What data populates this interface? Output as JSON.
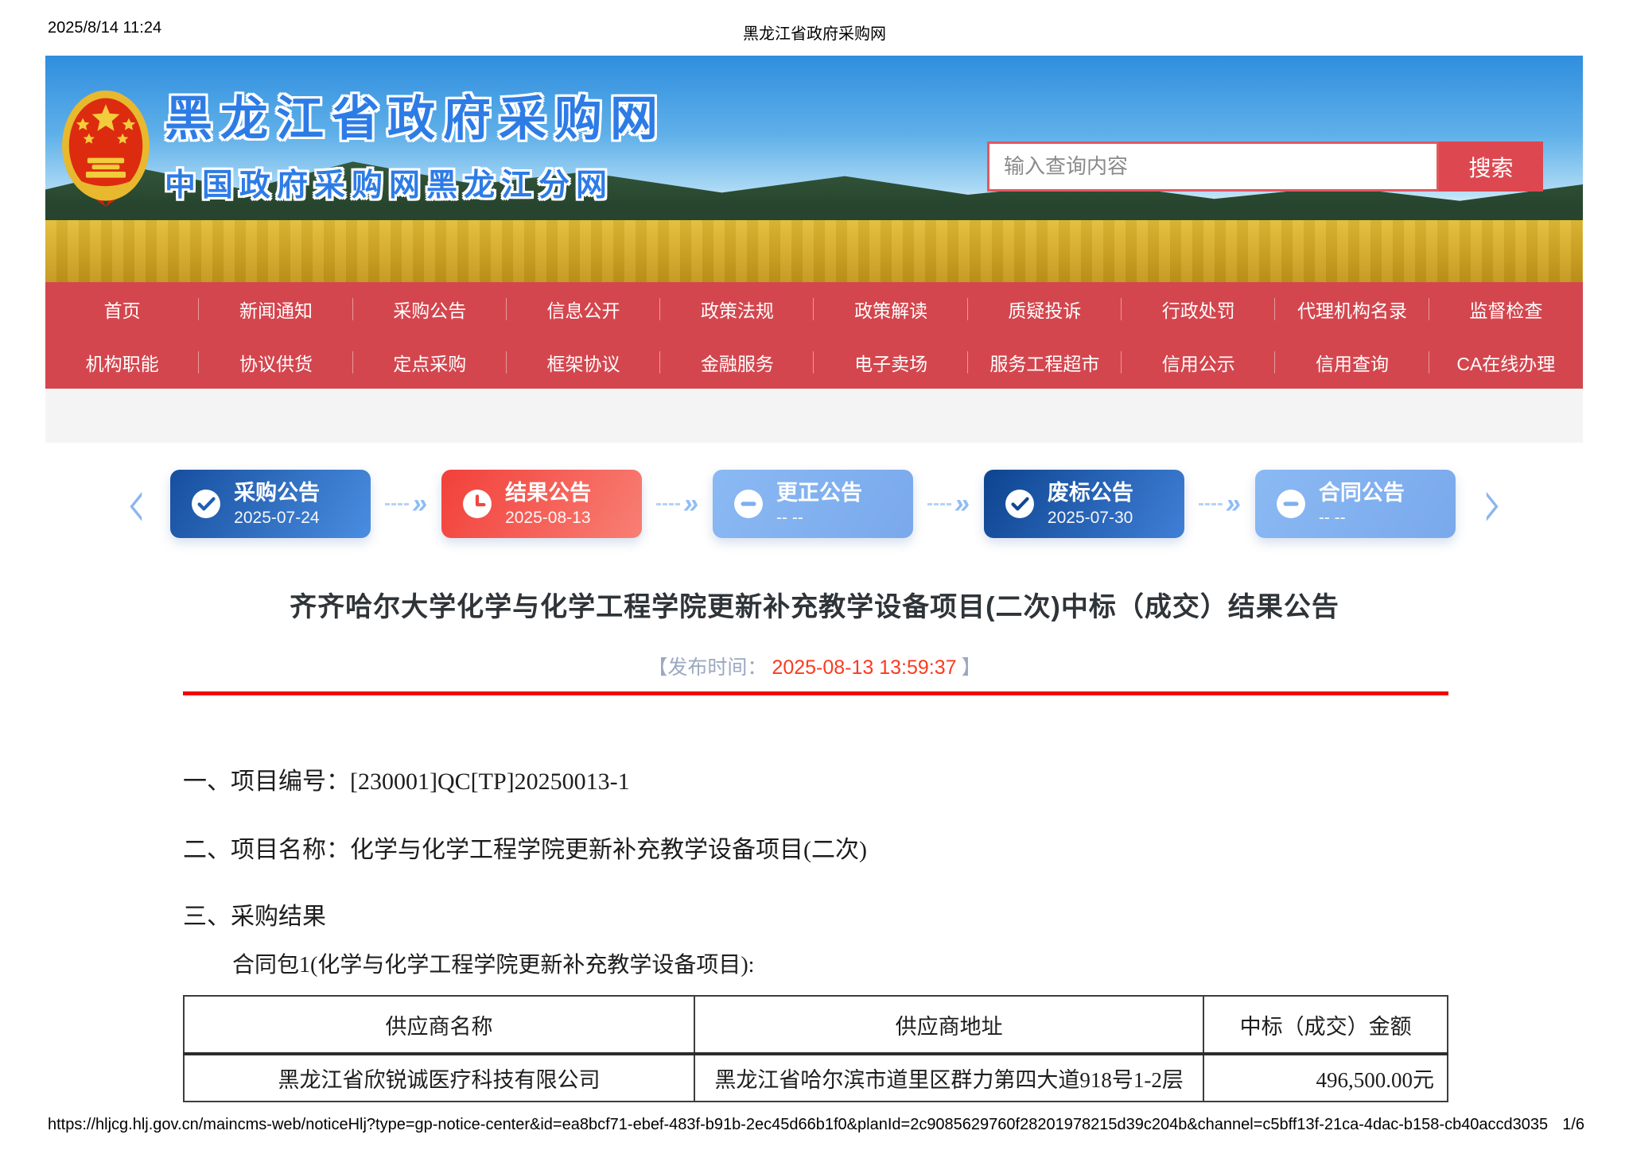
{
  "print_header": {
    "timestamp": "2025/8/14 11:24",
    "doc_title": "黑龙江省政府采购网"
  },
  "banner": {
    "site_title": "黑龙江省政府采购网",
    "site_subtitle": "中国政府采购网黑龙江分网",
    "search_placeholder": "输入查询内容",
    "search_button": "搜索"
  },
  "nav": {
    "row1": [
      "首页",
      "新闻通知",
      "采购公告",
      "信息公开",
      "政策法规",
      "政策解读",
      "质疑投诉",
      "行政处罚",
      "代理机构名录",
      "监督检查"
    ],
    "row2": [
      "机构职能",
      "协议供货",
      "定点采购",
      "框架协议",
      "金融服务",
      "电子卖场",
      "服务工程超市",
      "信用公示",
      "信用查询",
      "CA在线办理"
    ]
  },
  "process_flow": {
    "steps": [
      {
        "label": "采购公告",
        "date": "2025-07-24",
        "icon": "check-circle",
        "style": "blue"
      },
      {
        "label": "结果公告",
        "date": "2025-08-13",
        "icon": "clock",
        "style": "red"
      },
      {
        "label": "更正公告",
        "date": "-- --",
        "icon": "minus-circle",
        "style": "light-blue"
      },
      {
        "label": "废标公告",
        "date": "2025-07-30",
        "icon": "check-circle",
        "style": "dark-blue"
      },
      {
        "label": "合同公告",
        "date": "-- --",
        "icon": "minus-circle",
        "style": "light-blue"
      }
    ]
  },
  "icons": {
    "prev_glyph": "‹",
    "next_glyph": "›",
    "arrow_glyph": "»"
  },
  "article": {
    "title": "齐齐哈尔大学化学与化学工程学院更新补充教学设备项目(二次)中标（成交）结果公告",
    "publish_prefix": "【发布时间：",
    "publish_time": "2025-08-13 13:59:37",
    "publish_suffix": "】",
    "section1": "一、项目编号：[230001]QC[TP]20250013-1",
    "section2": "二、项目名称：化学与化学工程学院更新补充教学设备项目(二次)",
    "section3": "三、采购结果",
    "package_line": "合同包1(化学与化学工程学院更新补充教学设备项目):"
  },
  "result_table": {
    "headers": [
      "供应商名称",
      "供应商地址",
      "中标（成交）金额"
    ],
    "rows": [
      [
        "黑龙江省欣锐诚医疗科技有限公司",
        "黑龙江省哈尔滨市道里区群力第四大道918号1-2层",
        "496,500.00元"
      ]
    ]
  },
  "print_footer": {
    "url": "https://hljcg.hlj.gov.cn/maincms-web/noticeHlj?type=gp-notice-center&id=ea8bcf71-ebef-483f-b91b-2ec45d66b1f0&planId=2c9085629760f28201978215d39c204b&channel=c5bff13f-21ca-4dac-b158-cb40accd3035",
    "page": "1/6"
  },
  "colors": {
    "nav_red": "#d4464e",
    "search_button_red": "#dd4850",
    "banner_title_blue": "#2d7ce6",
    "publish_time_red": "#fb3a1f",
    "rule_red": "#f40000",
    "step_blue": "#1f5fb4",
    "step_red": "#f2453e",
    "step_light_blue": "#7fb0ee",
    "step_dark_blue": "#10478f"
  }
}
